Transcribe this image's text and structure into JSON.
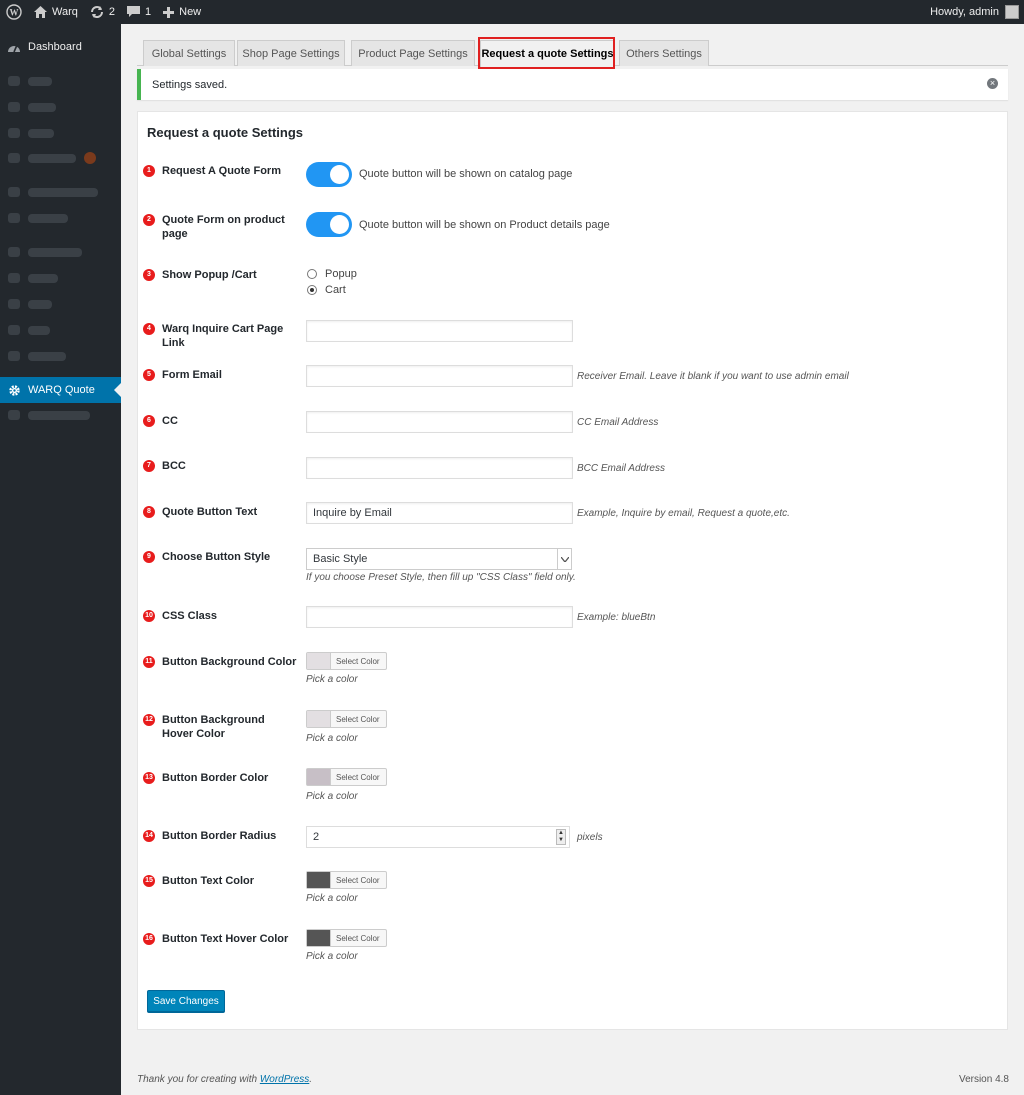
{
  "adminbar": {
    "site_name": "Warq",
    "updates_count": "2",
    "comments_count": "1",
    "new_label": "New",
    "greeting": "Howdy, admin"
  },
  "sidebar": {
    "dashboard_label": "Dashboard",
    "current_label": "WARQ Quote"
  },
  "tabs": [
    {
      "label": "Global Settings"
    },
    {
      "label": "Shop Page Settings"
    },
    {
      "label": "Product Page Settings"
    },
    {
      "label": "Request a quote Settings"
    },
    {
      "label": "Others Settings"
    }
  ],
  "notice": {
    "text": "Settings saved."
  },
  "panel": {
    "title": "Request a quote Settings",
    "fields": {
      "f1": {
        "num": "1",
        "label": "Request A Quote Form",
        "desc": "Quote button will be shown on catalog page"
      },
      "f2": {
        "num": "2",
        "label": "Quote Form on product page",
        "desc": "Quote button will be shown on Product details page"
      },
      "f3": {
        "num": "3",
        "label": "Show Popup /Cart",
        "opt1": "Popup",
        "opt2": "Cart"
      },
      "f4": {
        "num": "4",
        "label": "Warq Inquire Cart Page Link",
        "value": ""
      },
      "f5": {
        "num": "5",
        "label": "Form Email",
        "value": "",
        "desc": "Receiver Email. Leave it blank if you want to use admin email"
      },
      "f6": {
        "num": "6",
        "label": "CC",
        "value": "",
        "desc": "CC Email Address"
      },
      "f7": {
        "num": "7",
        "label": "BCC",
        "value": "",
        "desc": "BCC Email Address"
      },
      "f8": {
        "num": "8",
        "label": "Quote Button Text",
        "value": "Inquire by Email",
        "desc": "Example, Inquire by email, Request a quote,etc."
      },
      "f9": {
        "num": "9",
        "label": "Choose Button Style",
        "value": "Basic Style",
        "desc": "If you choose Preset Style, then fill up \"CSS Class\" field only."
      },
      "f10": {
        "num": "10",
        "label": "CSS Class",
        "value": "",
        "desc": "Example: blueBtn"
      },
      "f11": {
        "num": "11",
        "label": "Button Background Color",
        "button": "Select Color",
        "hint": "Pick a color",
        "color": "#e3dfe2"
      },
      "f12": {
        "num": "12",
        "label": "Button Background Hover Color",
        "button": "Select Color",
        "hint": "Pick a color",
        "color": "#e3dfe2"
      },
      "f13": {
        "num": "13",
        "label": "Button Border Color",
        "button": "Select Color",
        "hint": "Pick a color",
        "color": "#c7bfc6"
      },
      "f14": {
        "num": "14",
        "label": "Button Border Radius",
        "value": "2",
        "unit": "pixels"
      },
      "f15": {
        "num": "15",
        "label": "Button Text Color",
        "button": "Select Color",
        "hint": "Pick a color",
        "color": "#555555"
      },
      "f16": {
        "num": "16",
        "label": "Button Text Hover Color",
        "button": "Select Color",
        "hint": "Pick a color",
        "color": "#555555"
      }
    },
    "save_label": "Save Changes"
  },
  "footer": {
    "thanks_prefix": "Thank you for creating with ",
    "wp_link": "WordPress",
    "thanks_suffix": ".",
    "version": "Version 4.8"
  }
}
